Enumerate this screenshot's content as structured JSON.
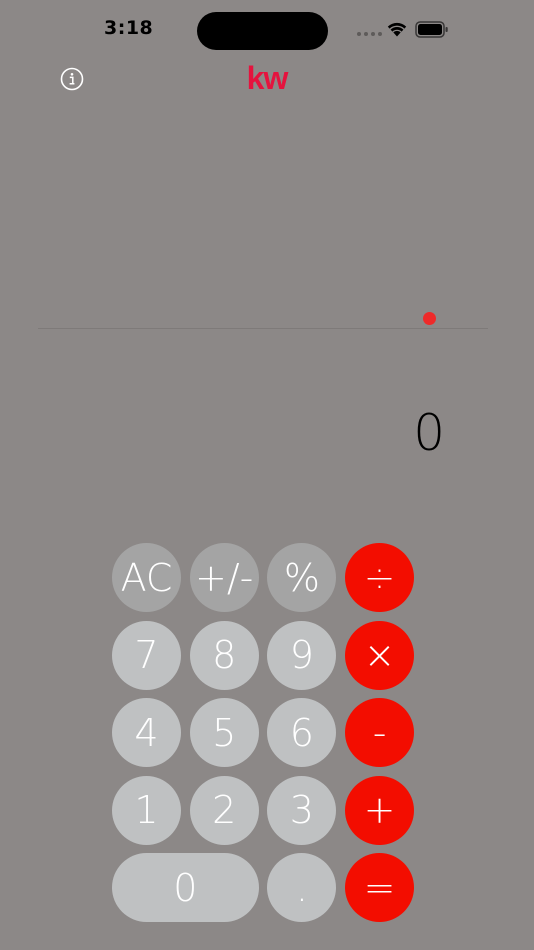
{
  "status_bar": {
    "time": "3:18"
  },
  "header": {
    "logo_text": "kw",
    "info_icon": "info-circle-icon"
  },
  "display": {
    "value": "0"
  },
  "colors": {
    "background": "#8c8887",
    "logo": "#e5133e",
    "operator": "#f30d00",
    "function_key": "#a4a4a4",
    "number_key": "#bfc1c2",
    "indicator": "#ee2a2a"
  },
  "keypad": {
    "rows": [
      [
        {
          "label": "AC",
          "type": "fn",
          "name": "clear-button"
        },
        {
          "label": "+/-",
          "type": "fn",
          "name": "sign-toggle-button"
        },
        {
          "label": "%",
          "type": "fn",
          "name": "percent-button"
        },
        {
          "label": "÷",
          "type": "op",
          "name": "divide-button"
        }
      ],
      [
        {
          "label": "7",
          "type": "num",
          "name": "digit-7-button"
        },
        {
          "label": "8",
          "type": "num",
          "name": "digit-8-button"
        },
        {
          "label": "9",
          "type": "num",
          "name": "digit-9-button"
        },
        {
          "label": "×",
          "type": "op",
          "name": "multiply-button"
        }
      ],
      [
        {
          "label": "4",
          "type": "num",
          "name": "digit-4-button"
        },
        {
          "label": "5",
          "type": "num",
          "name": "digit-5-button"
        },
        {
          "label": "6",
          "type": "num",
          "name": "digit-6-button"
        },
        {
          "label": "-",
          "type": "op",
          "name": "subtract-button"
        }
      ],
      [
        {
          "label": "1",
          "type": "num",
          "name": "digit-1-button"
        },
        {
          "label": "2",
          "type": "num",
          "name": "digit-2-button"
        },
        {
          "label": "3",
          "type": "num",
          "name": "digit-3-button"
        },
        {
          "label": "+",
          "type": "op",
          "name": "add-button"
        }
      ],
      [
        {
          "label": "0",
          "type": "num",
          "name": "digit-0-button",
          "wide": true
        },
        {
          "label": ".",
          "type": "num",
          "name": "decimal-button"
        },
        {
          "label": "=",
          "type": "op",
          "name": "equals-button"
        }
      ]
    ]
  }
}
